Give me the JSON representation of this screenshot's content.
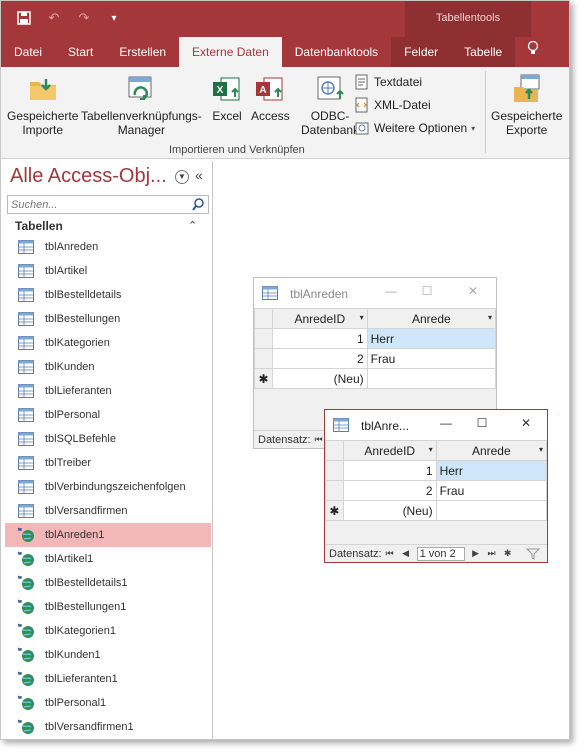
{
  "quick_access": {
    "save_icon": "save-icon",
    "undo_icon": "undo-icon",
    "redo_icon": "redo-icon",
    "customize_icon": "customize-qat-icon"
  },
  "contextual_tab_group": "Tabellentools",
  "ribbon_tabs": [
    {
      "label": "Datei"
    },
    {
      "label": "Start"
    },
    {
      "label": "Erstellen"
    },
    {
      "label": "Externe Daten"
    },
    {
      "label": "Datenbanktools"
    },
    {
      "label": "Felder"
    },
    {
      "label": "Tabelle"
    }
  ],
  "ribbon": {
    "saved_imports": "Gespeicherte\nImporte",
    "linked_table_manager": "Tabellenverknüpfungs-\nManager",
    "excel": "Excel",
    "access": "Access",
    "odbc": "ODBC-\nDatenbank",
    "text_file": "Textdatei",
    "xml_file": "XML-Datei",
    "more_options": "Weitere Optionen",
    "group_import": "Importieren und Verknüpfen",
    "saved_exports": "Gespeicherte\nExporte"
  },
  "nav": {
    "title": "Alle Access-Obj...",
    "search_placeholder": "Suchen...",
    "section": "Tabellen",
    "items": [
      {
        "label": "tblAnreden",
        "type": "table"
      },
      {
        "label": "tblArtikel",
        "type": "table"
      },
      {
        "label": "tblBestelldetails",
        "type": "table"
      },
      {
        "label": "tblBestellungen",
        "type": "table"
      },
      {
        "label": "tblKategorien",
        "type": "table"
      },
      {
        "label": "tblKunden",
        "type": "table"
      },
      {
        "label": "tblLieferanten",
        "type": "table"
      },
      {
        "label": "tblPersonal",
        "type": "table"
      },
      {
        "label": "tblSQLBefehle",
        "type": "table"
      },
      {
        "label": "tblTreiber",
        "type": "table"
      },
      {
        "label": "tblVerbindungszeichenfolgen",
        "type": "table"
      },
      {
        "label": "tblVersandfirmen",
        "type": "table"
      },
      {
        "label": "tblAnreden1",
        "type": "linked",
        "selected": true
      },
      {
        "label": "tblArtikel1",
        "type": "linked"
      },
      {
        "label": "tblBestelldetails1",
        "type": "linked"
      },
      {
        "label": "tblBestellungen1",
        "type": "linked"
      },
      {
        "label": "tblKategorien1",
        "type": "linked"
      },
      {
        "label": "tblKunden1",
        "type": "linked"
      },
      {
        "label": "tblLieferanten1",
        "type": "linked"
      },
      {
        "label": "tblPersonal1",
        "type": "linked"
      },
      {
        "label": "tblVersandfirmen1",
        "type": "linked"
      }
    ]
  },
  "window1": {
    "title": "tblAnreden",
    "columns": [
      "AnredeID",
      "Anrede"
    ],
    "rows": [
      [
        "1",
        "Herr"
      ],
      [
        "2",
        "Frau"
      ]
    ],
    "new_row": "(Neu)",
    "status_label": "Datensatz:"
  },
  "window2": {
    "title": "tblAnre...",
    "columns": [
      "AnredeID",
      "Anrede"
    ],
    "rows": [
      [
        "1",
        "Herr"
      ],
      [
        "2",
        "Frau"
      ]
    ],
    "new_row": "(Neu)",
    "status_label": "Datensatz:",
    "record_position": "1 von 2"
  },
  "colors": {
    "accent": "#a4373a",
    "selection": "#f4b7b9",
    "cell_highlight": "#cfe5fa"
  }
}
